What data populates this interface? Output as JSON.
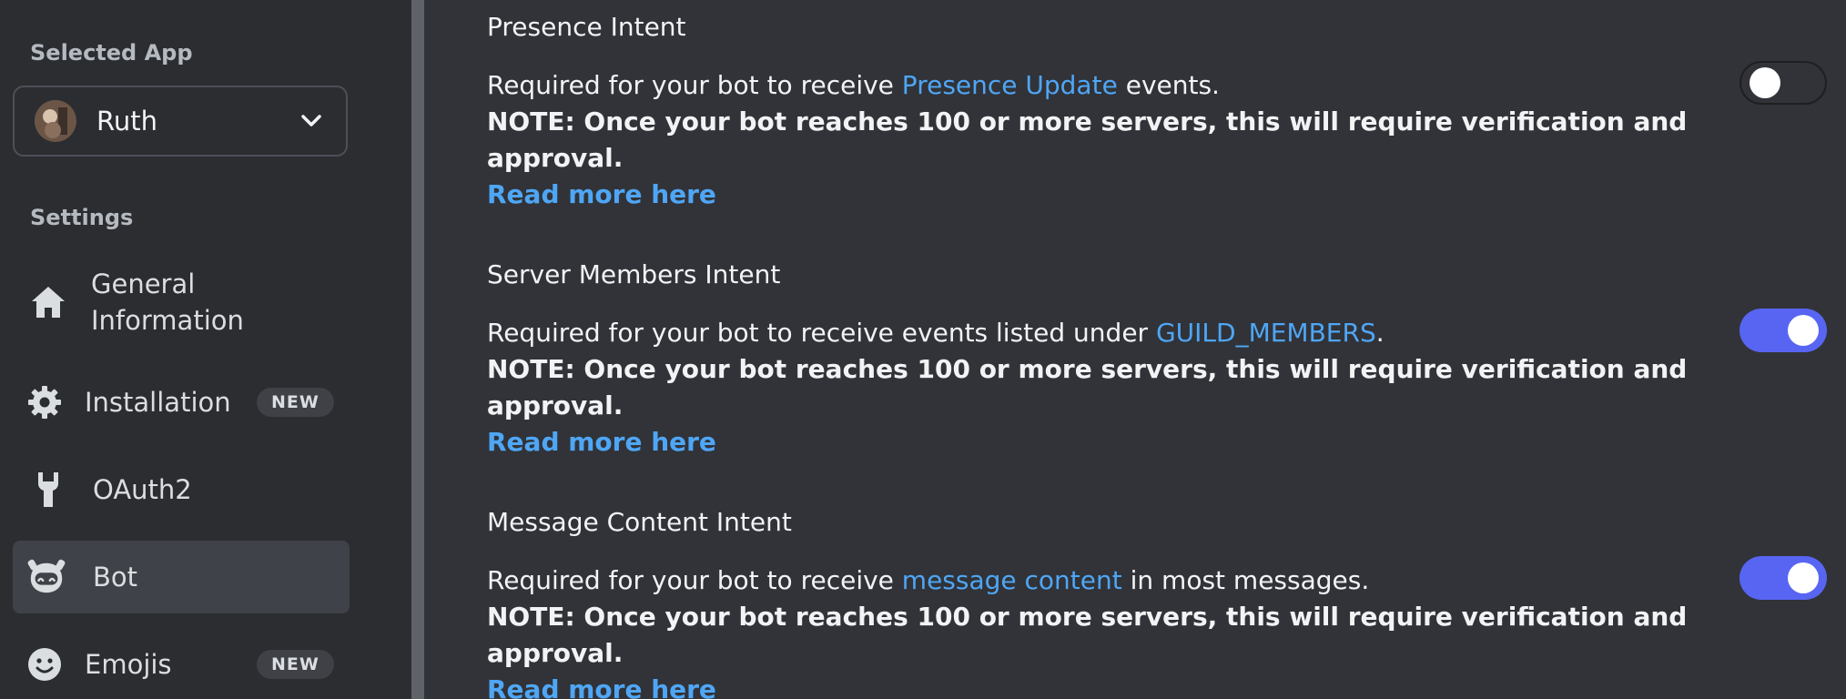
{
  "sidebar": {
    "selected_app_label": "Selected App",
    "app_name": "Ruth",
    "settings_label": "Settings",
    "items": [
      {
        "label": "General Information",
        "icon": "home-icon"
      },
      {
        "label": "Installation",
        "icon": "gear-icon",
        "badge": "NEW"
      },
      {
        "label": "OAuth2",
        "icon": "wrench-icon"
      },
      {
        "label": "Bot",
        "icon": "bot-icon",
        "active": true
      },
      {
        "label": "Emojis",
        "icon": "smile-icon",
        "badge": "NEW"
      }
    ]
  },
  "intents": [
    {
      "title": "Presence Intent",
      "desc_before": "Required for your bot to receive ",
      "desc_link": "Presence Update",
      "desc_after": " events.",
      "note": "NOTE: Once your bot reaches 100 or more servers, this will require verification and approval.",
      "read_more": "Read more here",
      "enabled": false
    },
    {
      "title": "Server Members Intent",
      "desc_before": "Required for your bot to receive events listed under ",
      "desc_link": "GUILD_MEMBERS",
      "desc_after": ".",
      "note": "NOTE: Once your bot reaches 100 or more servers, this will require verification and approval.",
      "read_more": "Read more here",
      "enabled": true
    },
    {
      "title": "Message Content Intent",
      "desc_before": "Required for your bot to receive ",
      "desc_link": "message content",
      "desc_after": " in most messages.",
      "note": "NOTE: Once your bot reaches 100 or more servers, this will require verification and approval.",
      "read_more": "Read more here",
      "enabled": true
    }
  ],
  "colors": {
    "accent": "#5865f2",
    "link": "#4fa6f5",
    "sidebar_bg": "#2b2d31",
    "main_bg": "#313338"
  }
}
